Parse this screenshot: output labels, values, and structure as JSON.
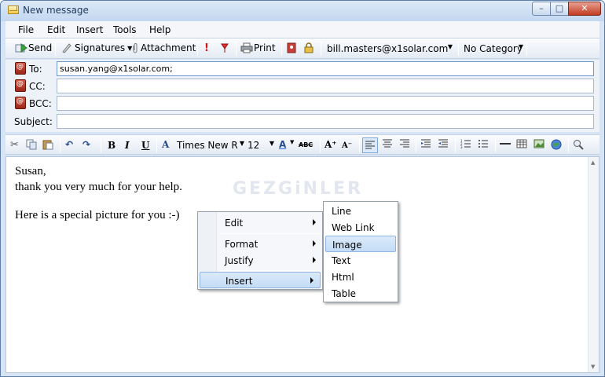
{
  "window": {
    "title": "New message",
    "controls": {
      "minimize": "–",
      "maximize": "□",
      "close": "✕"
    }
  },
  "menubar": [
    "File",
    "Edit",
    "Insert",
    "Tools",
    "Help"
  ],
  "toolbar": {
    "send": "Send",
    "signatures": "Signatures",
    "attachment": "Attachment",
    "print": "Print",
    "from_account": "bill.masters@x1solar.com",
    "category": "No Category"
  },
  "fields": {
    "to_label": "To:",
    "to_value": "susan.yang@x1solar.com;",
    "cc_label": "CC:",
    "cc_value": "",
    "bcc_label": "BCC:",
    "bcc_value": "",
    "subject_label": "Subject:",
    "subject_value": ""
  },
  "format_toolbar": {
    "font": "Times New R",
    "size": "12",
    "bold": "B",
    "italic": "I",
    "underline": "U",
    "strike": "ABC"
  },
  "editor": {
    "lines": [
      "Susan,",
      "thank you very much for your help.",
      "",
      "Here is a special picture for you :-)"
    ],
    "watermark": "GEZGiNLER"
  },
  "context_menu": {
    "items": [
      "Edit",
      "Format",
      "Justify",
      "Insert"
    ],
    "highlighted": "Insert"
  },
  "insert_submenu": {
    "items": [
      "Line",
      "Web Link",
      "Image",
      "Text",
      "Html",
      "Table"
    ],
    "highlighted": "Image"
  },
  "colors": {
    "accent": "#c3dcf6",
    "frame": "#d6e4f5",
    "close_button": "#c23b22"
  }
}
